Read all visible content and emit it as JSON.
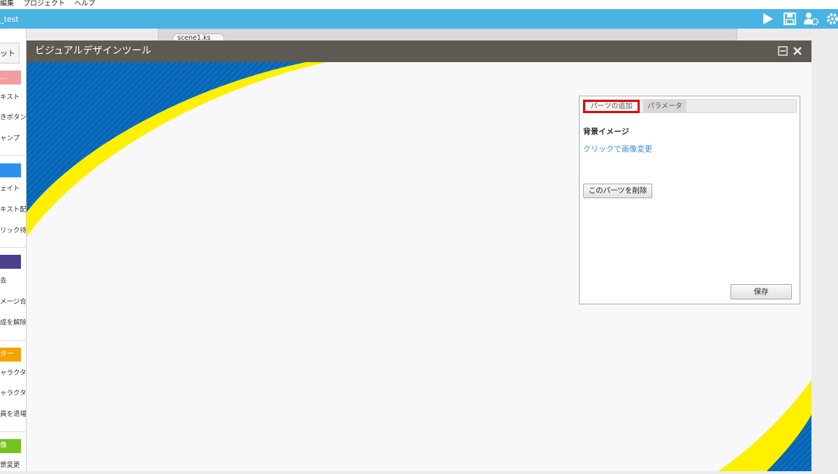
{
  "menubar": {
    "items": [
      "編集",
      "プロジェクト",
      "ヘルプ"
    ]
  },
  "appbar": {
    "title": "_test",
    "tools": [
      "play-icon",
      "save-icon",
      "users-settings-icon",
      "gear-icon"
    ],
    "accent": "#49b3e3"
  },
  "leftpanel": {
    "tab": "ット",
    "groups": [
      {
        "band": "…",
        "color": "#f19ea0",
        "items": [
          "キスト",
          "きボタン",
          "ャンプ"
        ]
      },
      {
        "band": "",
        "color": "#2b8ff0",
        "items": [
          "ェイト",
          "キスト配置",
          "リック待ち"
        ]
      },
      {
        "band": "",
        "color": "#4c3f8e",
        "items": [
          "去",
          "メージ合成",
          "成を解除"
        ]
      },
      {
        "band": "ター",
        "color": "#f5a300",
        "items": [
          "ャラクター",
          "ャラクター",
          "員を退場"
        ]
      },
      {
        "band": "像",
        "color": "#74c21c",
        "items": [
          "景変更"
        ]
      }
    ]
  },
  "editor": {
    "tab": "scene1.ks"
  },
  "window": {
    "title": "ビジュアルデザインツール"
  },
  "panel": {
    "tabs": [
      "パーツの追加",
      "パラメータ"
    ],
    "section_title": "背景イメージ",
    "change_image_link": "クリックで画像変更",
    "delete_button": "このパーツを削除",
    "save_button": "保存"
  },
  "colors": {
    "title_bar": "#5e5a53",
    "stripe_blue": "#0a6fc2",
    "stripe_yellow": "#fff000",
    "highlight": "#e60000"
  }
}
